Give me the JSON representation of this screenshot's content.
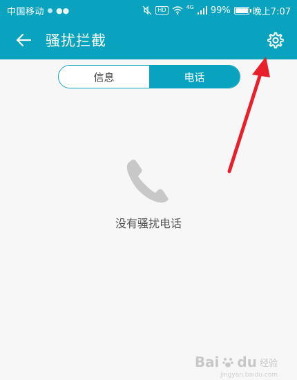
{
  "status_bar": {
    "carrier": "中国移动",
    "network_label": "4G",
    "hd_label": "HD",
    "battery_percent_text": "99%",
    "battery_level": 0.99,
    "time": "晚上7:07"
  },
  "app_bar": {
    "title": "骚扰拦截"
  },
  "tabs": [
    {
      "label": "信息",
      "active": false
    },
    {
      "label": "电话",
      "active": true
    }
  ],
  "empty_state": {
    "message": "没有骚扰电话"
  },
  "watermark": {
    "brand": "Bai",
    "brand_suffix": "du",
    "sub": "经验",
    "url": "jingyan.baidu.com"
  },
  "colors": {
    "accent": "#0aa3bf",
    "annotation_arrow": "#e8202a",
    "icon_gray": "#c8c8c8"
  }
}
